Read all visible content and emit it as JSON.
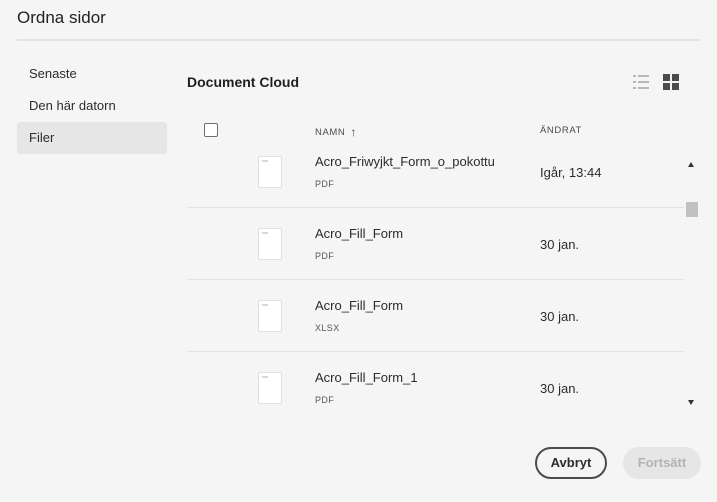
{
  "dialog": {
    "title": "Ordna sidor"
  },
  "sidebar": {
    "items": [
      {
        "label": "Senaste",
        "active": false
      },
      {
        "label": "Den här datorn",
        "active": false
      },
      {
        "label": "Filer",
        "active": true
      }
    ]
  },
  "main": {
    "title": "Document Cloud",
    "view_icons": [
      "list-view-icon",
      "grid-view-icon"
    ],
    "columns": {
      "name": "NAMN",
      "changed": "ÄNDRAT",
      "sort_direction": "ascending"
    },
    "files": [
      {
        "name": "Acro_Friwyjkt_Form_o_pokottu",
        "type": "PDF",
        "date": "Igår, 13:44"
      },
      {
        "name": "Acro_Fill_Form",
        "type": "PDF",
        "date": "30 jan."
      },
      {
        "name": "Acro_Fill_Form",
        "type": "XLSX",
        "date": "30 jan."
      },
      {
        "name": "Acro_Fill_Form_1",
        "type": "PDF",
        "date": "30 jan."
      }
    ]
  },
  "footer": {
    "cancel_label": "Avbryt",
    "continue_label": "Fortsätt"
  },
  "colors": {
    "background": "#f5f5f5",
    "active_item": "#e6e6e6",
    "disabled_text": "#b3b3b3"
  }
}
